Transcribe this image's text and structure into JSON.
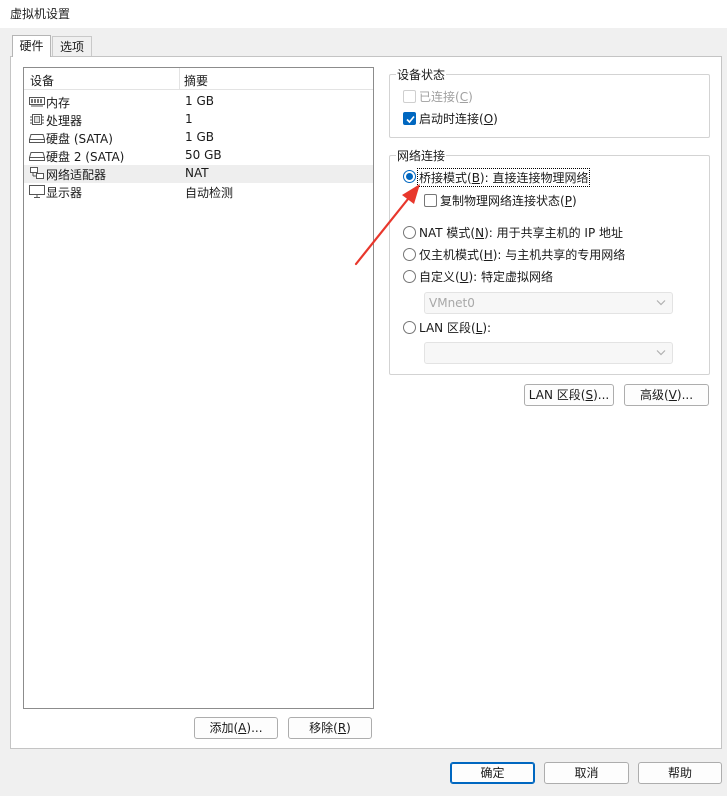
{
  "window": {
    "title": "虚拟机设置"
  },
  "tabs": [
    {
      "label": "硬件",
      "active": true
    },
    {
      "label": "选项",
      "active": false
    }
  ],
  "device_list": {
    "columns": [
      "设备",
      "摘要"
    ],
    "rows": [
      {
        "name": "内存",
        "summary": "1 GB",
        "icon": "memory-icon"
      },
      {
        "name": "处理器",
        "summary": "1",
        "icon": "cpu-icon"
      },
      {
        "name": "硬盘 (SATA)",
        "summary": "1 GB",
        "icon": "hard-disk-icon"
      },
      {
        "name": "硬盘 2 (SATA)",
        "summary": "50 GB",
        "icon": "hard-disk-icon"
      },
      {
        "name": "网络适配器",
        "summary": "NAT",
        "icon": "network-adapter-icon",
        "selected": true
      },
      {
        "name": "显示器",
        "summary": "自动检测",
        "icon": "display-icon"
      }
    ]
  },
  "list_buttons": {
    "add": {
      "text": "添加(",
      "key": "A",
      "tail": ")..."
    },
    "remove": {
      "text": "移除(",
      "key": "R",
      "tail": ")"
    }
  },
  "device_status": {
    "group_label": "设备状态",
    "connected": {
      "text": "已连接(",
      "key": "C",
      "tail": ")",
      "checked": false,
      "disabled": true
    },
    "connect_at_power_on": {
      "text": "启动时连接(",
      "key": "O",
      "tail": ")",
      "checked": true
    }
  },
  "network_connection": {
    "group_label": "网络连接",
    "bridged": {
      "text": "桥接模式(",
      "key": "B",
      "tail": "): 直接连接物理网络",
      "selected": true
    },
    "replicate": {
      "text": "复制物理网络连接状态(",
      "key": "P",
      "tail": ")",
      "checked": false
    },
    "nat": {
      "text": "NAT 模式(",
      "key": "N",
      "tail": "): 用于共享主机的 IP 地址",
      "selected": false
    },
    "host_only": {
      "text": "仅主机模式(",
      "key": "H",
      "tail": "): 与主机共享的专用网络",
      "selected": false
    },
    "custom": {
      "text": "自定义(",
      "key": "U",
      "tail": "): 特定虚拟网络",
      "selected": false
    },
    "custom_value": "VMnet0",
    "lan_segment": {
      "text": "LAN 区段(",
      "key": "L",
      "tail": "):",
      "selected": false
    },
    "lan_segment_value": ""
  },
  "side_buttons": {
    "lan_segments": {
      "text": "LAN 区段(",
      "key": "S",
      "tail": ")..."
    },
    "advanced": {
      "text": "高级(",
      "key": "V",
      "tail": ")..."
    }
  },
  "footer_buttons": {
    "ok": "确定",
    "cancel": "取消",
    "help": "帮助"
  },
  "colors": {
    "accent": "#0067c0",
    "annotation_arrow": "#e8372c"
  }
}
